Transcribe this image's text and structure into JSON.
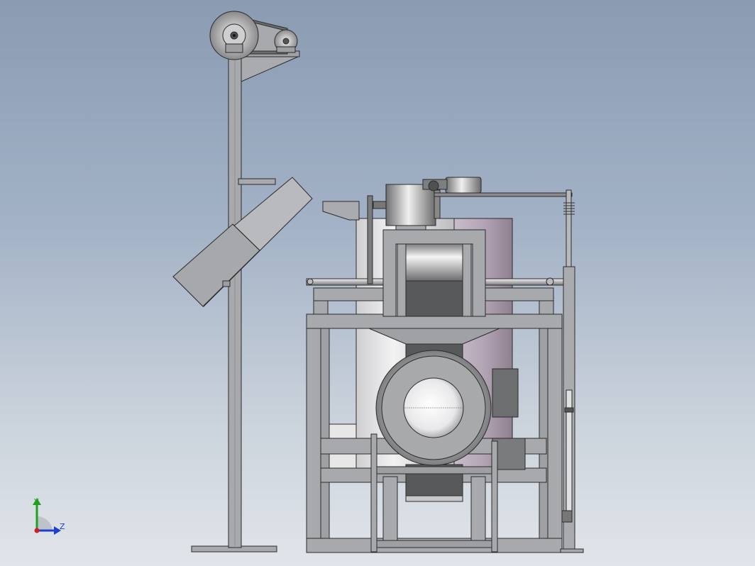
{
  "scene": {
    "colors": {
      "background_top": "#8a9bb2",
      "background_bottom": "#e1e5ea",
      "frame": "#a7a9ac",
      "frame_shadow": "#8e9093",
      "edge": "#2b2b2b",
      "belt": "#58595b",
      "drum": "#9a9c9f",
      "tank_light": "#e4e4e6",
      "tank_purple": "#b7a9b8",
      "triad_x": "#d11f1f",
      "triad_y": "#1fa01f",
      "triad_z": "#1f3fd1"
    }
  },
  "triad": {
    "y_label": "Y",
    "z_label": "Z"
  }
}
